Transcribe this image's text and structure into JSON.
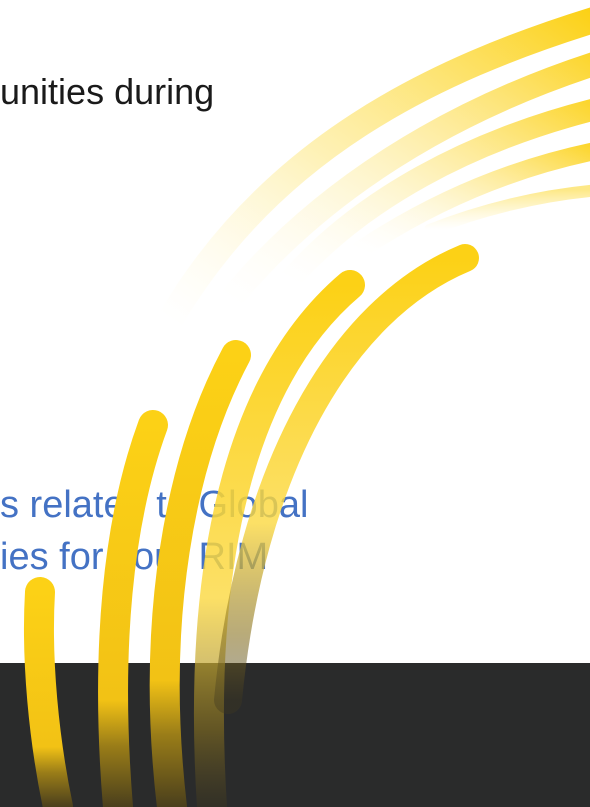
{
  "slide": {
    "heading_fragment": "unities during",
    "subtext_lines": [
      "s related to Global",
      "ies for your RIM"
    ]
  },
  "colors": {
    "accent_yellow": "#fcd116",
    "subtext_blue": "#4472c4",
    "footer_band": "#2a2b2b",
    "heading_text": "#1a1a1a"
  },
  "decorations": {
    "graphic": "concentric-yellow-arc-swooshes"
  }
}
